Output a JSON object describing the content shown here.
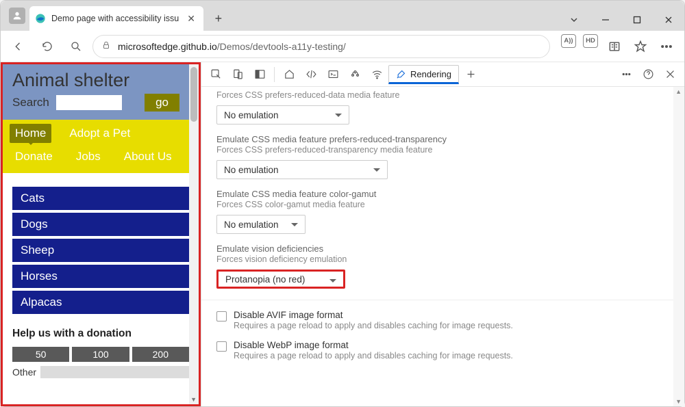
{
  "browser": {
    "tab_title": "Demo page with accessibility issu",
    "url_host": "microsoftedge.github.io",
    "url_path": "/Demos/devtools-a11y-testing/",
    "badge_aa": "A))",
    "badge_hd": "HD"
  },
  "page": {
    "title": "Animal shelter",
    "search_label": "Search",
    "go": "go",
    "nav": [
      "Home",
      "Adopt a Pet",
      "Donate",
      "Jobs",
      "About Us"
    ],
    "cats": [
      "Cats",
      "Dogs",
      "Sheep",
      "Horses",
      "Alpacas"
    ],
    "donate_heading": "Help us with a donation",
    "amounts": [
      "50",
      "100",
      "200"
    ],
    "other": "Other"
  },
  "devtools": {
    "tab": "Rendering",
    "s1_sub": "Forces CSS prefers-reduced-data media feature",
    "s1_val": "No emulation",
    "s2_lbl": "Emulate CSS media feature prefers-reduced-transparency",
    "s2_sub": "Forces CSS prefers-reduced-transparency media feature",
    "s2_val": "No emulation",
    "s3_lbl": "Emulate CSS media feature color-gamut",
    "s3_sub": "Forces CSS color-gamut media feature",
    "s3_val": "No emulation",
    "s4_lbl": "Emulate vision deficiencies",
    "s4_sub": "Forces vision deficiency emulation",
    "s4_val": "Protanopia (no red)",
    "c1_t": "Disable AVIF image format",
    "c1_s": "Requires a page reload to apply and disables caching for image requests.",
    "c2_t": "Disable WebP image format",
    "c2_s": "Requires a page reload to apply and disables caching for image requests."
  }
}
